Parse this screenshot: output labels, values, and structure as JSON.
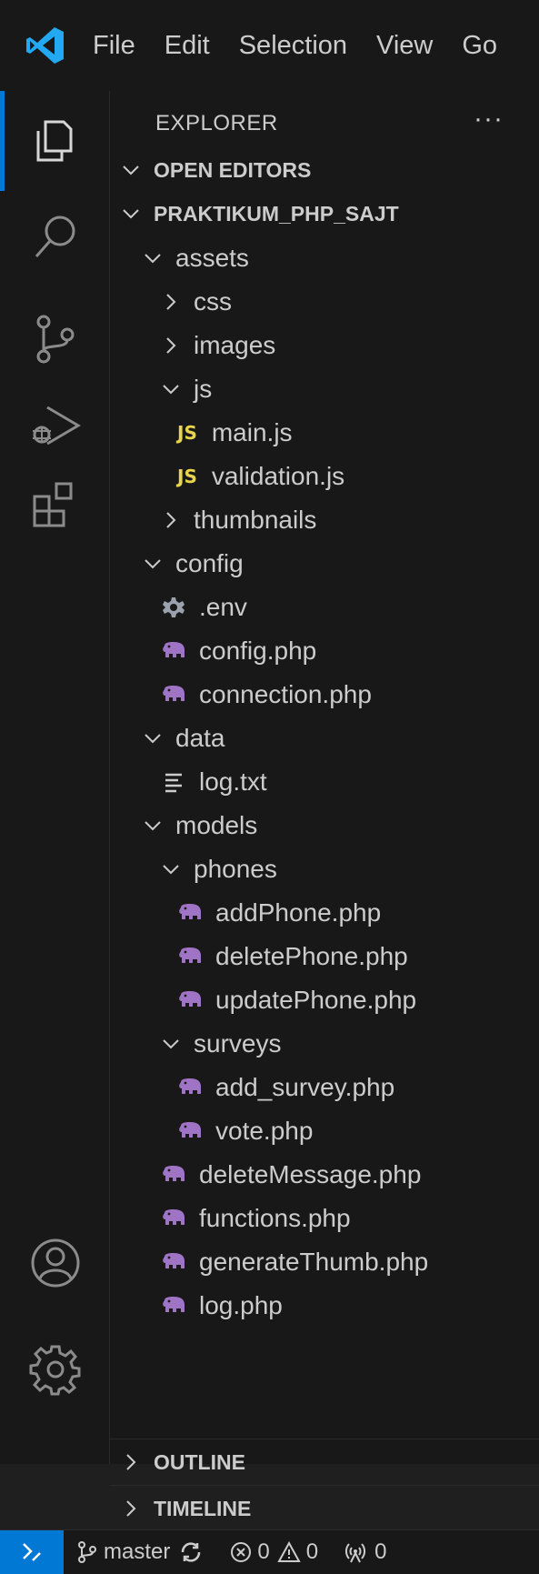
{
  "menu": [
    "File",
    "Edit",
    "Selection",
    "View",
    "Go"
  ],
  "activity_icons": [
    "explorer-icon",
    "search-icon",
    "source-control-icon",
    "run-debug-icon",
    "extensions-icon",
    "account-icon",
    "settings-gear-icon"
  ],
  "explorer": {
    "title": "EXPLORER",
    "more": "···",
    "open_editors": "OPEN EDITORS",
    "project": "PRAKTIKUM_PHP_SAJT"
  },
  "tree": [
    {
      "label": "assets",
      "kind": "folder-open",
      "depth": 1
    },
    {
      "label": "css",
      "kind": "folder-closed",
      "depth": 2
    },
    {
      "label": "images",
      "kind": "folder-closed",
      "depth": 2
    },
    {
      "label": "js",
      "kind": "folder-open",
      "depth": 2
    },
    {
      "label": "main.js",
      "kind": "js",
      "depth": 3
    },
    {
      "label": "validation.js",
      "kind": "js",
      "depth": 3
    },
    {
      "label": "thumbnails",
      "kind": "folder-closed",
      "depth": 2
    },
    {
      "label": "config",
      "kind": "folder-open",
      "depth": 1
    },
    {
      "label": ".env",
      "kind": "env",
      "depth": 2
    },
    {
      "label": "config.php",
      "kind": "php",
      "depth": 2
    },
    {
      "label": "connection.php",
      "kind": "php",
      "depth": 2
    },
    {
      "label": "data",
      "kind": "folder-open",
      "depth": 1
    },
    {
      "label": "log.txt",
      "kind": "txt",
      "depth": 2
    },
    {
      "label": "models",
      "kind": "folder-open",
      "depth": 1
    },
    {
      "label": "phones",
      "kind": "folder-open",
      "depth": 2
    },
    {
      "label": "addPhone.php",
      "kind": "php",
      "depth": 3
    },
    {
      "label": "deletePhone.php",
      "kind": "php",
      "depth": 3
    },
    {
      "label": "updatePhone.php",
      "kind": "php",
      "depth": 3
    },
    {
      "label": "surveys",
      "kind": "folder-open",
      "depth": 2
    },
    {
      "label": "add_survey.php",
      "kind": "php",
      "depth": 3
    },
    {
      "label": "vote.php",
      "kind": "php",
      "depth": 3
    },
    {
      "label": "deleteMessage.php",
      "kind": "php",
      "depth": 2
    },
    {
      "label": "functions.php",
      "kind": "php",
      "depth": 2
    },
    {
      "label": "generateThumb.php",
      "kind": "php",
      "depth": 2
    },
    {
      "label": "log.php",
      "kind": "php",
      "depth": 2
    }
  ],
  "bottom_sections": [
    "OUTLINE",
    "TIMELINE"
  ],
  "status": {
    "branch": "master",
    "errors": "0",
    "warnings": "0",
    "ports": "0"
  },
  "colors": {
    "accent": "#0078d4",
    "php_icon": "#a074c4",
    "js_icon": "#e8d44d",
    "vscode_logo": "#23a8f2"
  }
}
